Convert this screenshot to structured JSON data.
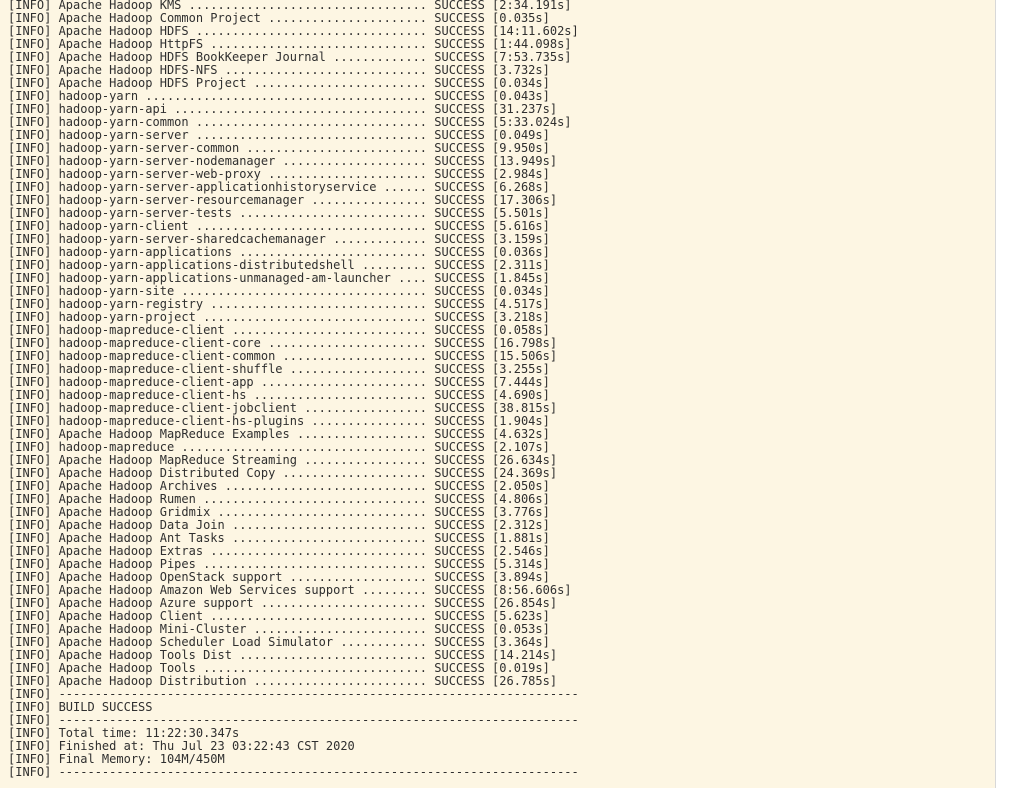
{
  "terminal": {
    "background": "#fdf6e3",
    "text_color": "#2f2f2f",
    "lines": [
      "[INFO] Apache Hadoop KMS ................................. SUCCESS [2:34.191s]",
      "[INFO] Apache Hadoop Common Project ...................... SUCCESS [0.035s]",
      "[INFO] Apache Hadoop HDFS ................................ SUCCESS [14:11.602s]",
      "[INFO] Apache Hadoop HttpFS .............................. SUCCESS [1:44.098s]",
      "[INFO] Apache Hadoop HDFS BookKeeper Journal ............. SUCCESS [7:53.735s]",
      "[INFO] Apache Hadoop HDFS-NFS ............................ SUCCESS [3.732s]",
      "[INFO] Apache Hadoop HDFS Project ........................ SUCCESS [0.034s]",
      "[INFO] hadoop-yarn ....................................... SUCCESS [0.043s]",
      "[INFO] hadoop-yarn-api ................................... SUCCESS [31.237s]",
      "[INFO] hadoop-yarn-common ................................ SUCCESS [5:33.024s]",
      "[INFO] hadoop-yarn-server ................................ SUCCESS [0.049s]",
      "[INFO] hadoop-yarn-server-common ......................... SUCCESS [9.950s]",
      "[INFO] hadoop-yarn-server-nodemanager .................... SUCCESS [13.949s]",
      "[INFO] hadoop-yarn-server-web-proxy ...................... SUCCESS [2.984s]",
      "[INFO] hadoop-yarn-server-applicationhistoryservice ...... SUCCESS [6.268s]",
      "[INFO] hadoop-yarn-server-resourcemanager ................ SUCCESS [17.306s]",
      "[INFO] hadoop-yarn-server-tests .......................... SUCCESS [5.501s]",
      "[INFO] hadoop-yarn-client ................................ SUCCESS [5.616s]",
      "[INFO] hadoop-yarn-server-sharedcachemanager ............. SUCCESS [3.159s]",
      "[INFO] hadoop-yarn-applications .......................... SUCCESS [0.036s]",
      "[INFO] hadoop-yarn-applications-distributedshell ......... SUCCESS [2.311s]",
      "[INFO] hadoop-yarn-applications-unmanaged-am-launcher .... SUCCESS [1.845s]",
      "[INFO] hadoop-yarn-site .................................. SUCCESS [0.034s]",
      "[INFO] hadoop-yarn-registry .............................. SUCCESS [4.517s]",
      "[INFO] hadoop-yarn-project ............................... SUCCESS [3.218s]",
      "[INFO] hadoop-mapreduce-client ........................... SUCCESS [0.058s]",
      "[INFO] hadoop-mapreduce-client-core ...................... SUCCESS [16.798s]",
      "[INFO] hadoop-mapreduce-client-common .................... SUCCESS [15.506s]",
      "[INFO] hadoop-mapreduce-client-shuffle ................... SUCCESS [3.255s]",
      "[INFO] hadoop-mapreduce-client-app ....................... SUCCESS [7.444s]",
      "[INFO] hadoop-mapreduce-client-hs ........................ SUCCESS [4.690s]",
      "[INFO] hadoop-mapreduce-client-jobclient ................. SUCCESS [38.815s]",
      "[INFO] hadoop-mapreduce-client-hs-plugins ................ SUCCESS [1.904s]",
      "[INFO] Apache Hadoop MapReduce Examples .................. SUCCESS [4.632s]",
      "[INFO] hadoop-mapreduce .................................. SUCCESS [2.107s]",
      "[INFO] Apache Hadoop MapReduce Streaming ................. SUCCESS [26.634s]",
      "[INFO] Apache Hadoop Distributed Copy .................... SUCCESS [24.369s]",
      "[INFO] Apache Hadoop Archives ............................ SUCCESS [2.050s]",
      "[INFO] Apache Hadoop Rumen ............................... SUCCESS [4.806s]",
      "[INFO] Apache Hadoop Gridmix ............................. SUCCESS [3.776s]",
      "[INFO] Apache Hadoop Data Join ........................... SUCCESS [2.312s]",
      "[INFO] Apache Hadoop Ant Tasks ........................... SUCCESS [1.881s]",
      "[INFO] Apache Hadoop Extras .............................. SUCCESS [2.546s]",
      "[INFO] Apache Hadoop Pipes ............................... SUCCESS [5.314s]",
      "[INFO] Apache Hadoop OpenStack support ................... SUCCESS [3.894s]",
      "[INFO] Apache Hadoop Amazon Web Services support ......... SUCCESS [8:56.606s]",
      "[INFO] Apache Hadoop Azure support ....................... SUCCESS [26.854s]",
      "[INFO] Apache Hadoop Client .............................. SUCCESS [5.623s]",
      "[INFO] Apache Hadoop Mini-Cluster ........................ SUCCESS [0.053s]",
      "[INFO] Apache Hadoop Scheduler Load Simulator ............ SUCCESS [3.364s]",
      "[INFO] Apache Hadoop Tools Dist .......................... SUCCESS [14.214s]",
      "[INFO] Apache Hadoop Tools ............................... SUCCESS [0.019s]",
      "[INFO] Apache Hadoop Distribution ........................ SUCCESS [26.785s]",
      "[INFO] ------------------------------------------------------------------------",
      "[INFO] BUILD SUCCESS",
      "[INFO] ------------------------------------------------------------------------",
      "[INFO] Total time: 11:22:30.347s",
      "[INFO] Finished at: Thu Jul 23 03:22:43 CST 2020",
      "[INFO] Final Memory: 104M/450M",
      "[INFO] ------------------------------------------------------------------------"
    ]
  }
}
